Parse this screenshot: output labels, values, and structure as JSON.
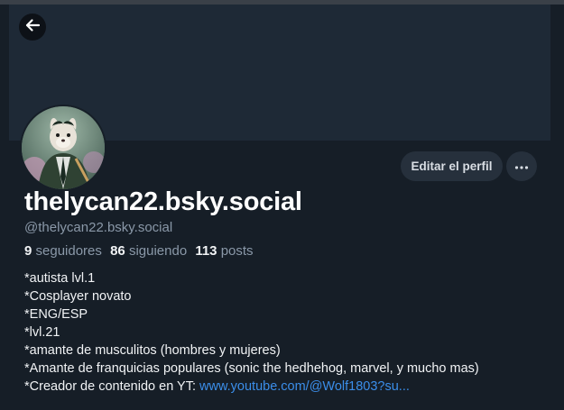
{
  "profile": {
    "display_name": "thelycan22.bsky.social",
    "handle": "@thelycan22.bsky.social",
    "stats": {
      "followers_count": "9",
      "followers_label": "seguidores",
      "following_count": "86",
      "following_label": "siguiendo",
      "posts_count": "113",
      "posts_label": "posts"
    },
    "bio_lines": [
      "*autista lvl.1",
      "*Cosplayer novato",
      "*ENG/ESP",
      "*lvl.21",
      "*amante de musculitos (hombres y mujeres)",
      "*Amante de franquicias populares (sonic the hedhehog, marvel, y mucho mas)"
    ],
    "bio_last_prefix": "*Creador de contenido en YT: ",
    "bio_link": "www.youtube.com/@Wolf1803?su..."
  },
  "buttons": {
    "edit_profile_label": "Editar el perfil",
    "more_label": "···"
  },
  "icons": {
    "back": "arrow-left-icon",
    "more": "ellipsis-icon"
  },
  "colors": {
    "background": "#161e27",
    "banner": "#1e2936",
    "link": "#3b8eea",
    "muted": "#8a98a8",
    "button_bg": "#26303c"
  }
}
